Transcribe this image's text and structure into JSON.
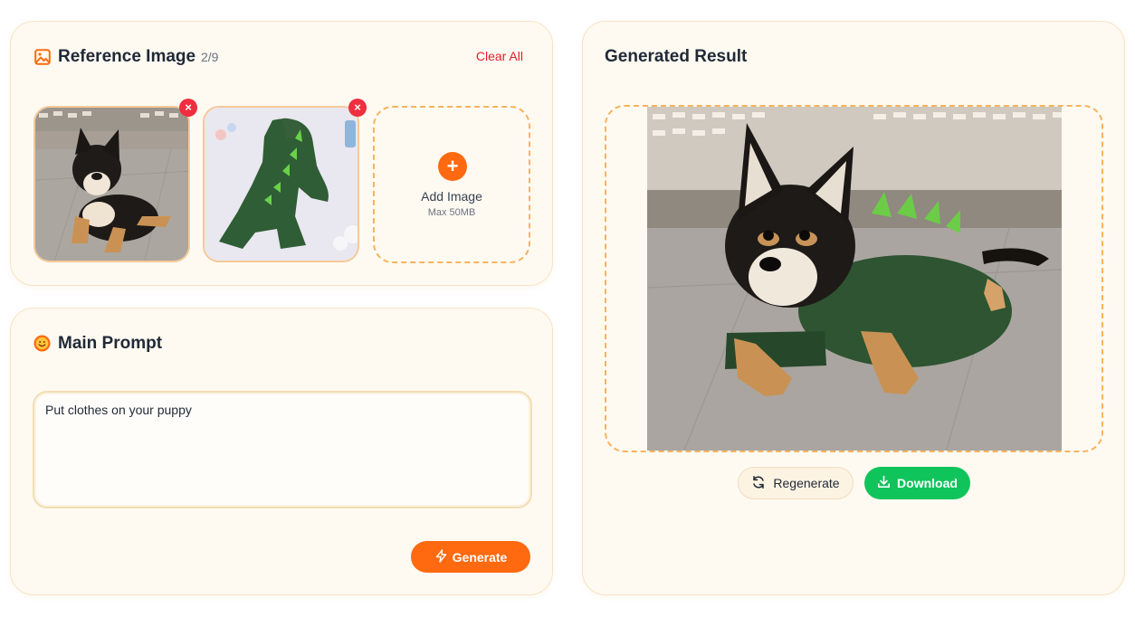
{
  "reference": {
    "title": "Reference Image",
    "count": "2/9",
    "clear_label": "Clear All",
    "thumbs": [
      {
        "remove_glyph": "×"
      },
      {
        "remove_glyph": "×"
      }
    ],
    "add": {
      "plus": "+",
      "label": "Add Image",
      "sub": "Max 50MB"
    }
  },
  "prompt": {
    "title": "Main Prompt",
    "value": "Put clothes on your puppy",
    "generate_label": "Generate"
  },
  "result": {
    "title": "Generated Result",
    "regenerate_label": "Regenerate",
    "download_label": "Download"
  },
  "colors": {
    "accent": "#ff6a10",
    "danger": "#ef2e3f",
    "success": "#10c45c",
    "card_bg": "#fffaf1",
    "dashed_border": "#f6b35f"
  }
}
